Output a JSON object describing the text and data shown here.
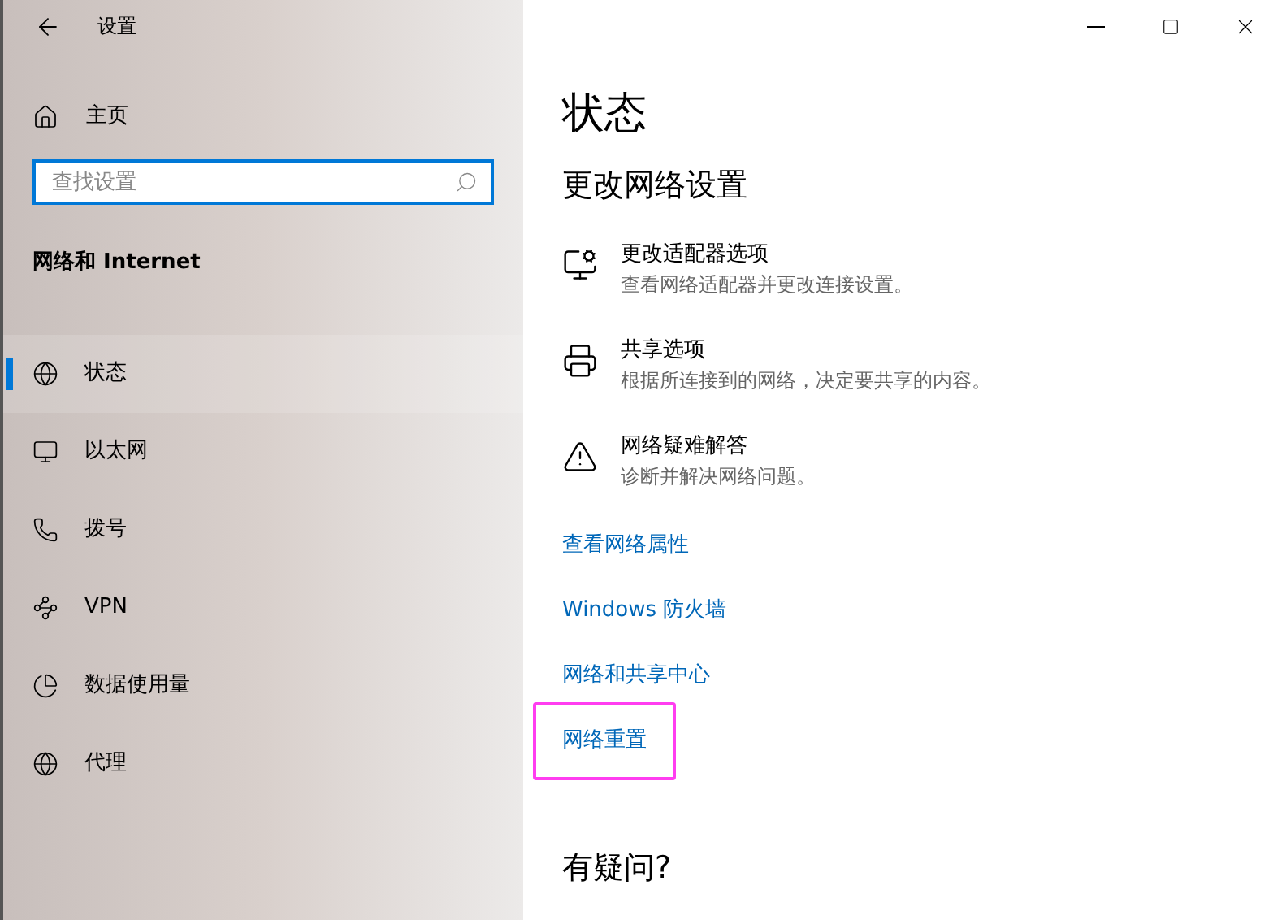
{
  "window": {
    "title": "设置"
  },
  "sidebar": {
    "home": "主页",
    "search": {
      "placeholder": "查找设置"
    },
    "section": "网络和 Internet",
    "items": [
      {
        "kind": "status",
        "label": "状态",
        "selected": true
      },
      {
        "kind": "ethernet",
        "label": "以太网",
        "selected": false
      },
      {
        "kind": "dialup",
        "label": "拨号",
        "selected": false
      },
      {
        "kind": "vpn",
        "label": "VPN",
        "selected": false
      },
      {
        "kind": "data",
        "label": "数据使用量",
        "selected": false
      },
      {
        "kind": "proxy",
        "label": "代理",
        "selected": false
      }
    ]
  },
  "main": {
    "title": "状态",
    "subtitle": "更改网络设置",
    "options": [
      {
        "kind": "adapter",
        "title": "更改适配器选项",
        "description": "查看网络适配器并更改连接设置。"
      },
      {
        "kind": "sharing",
        "title": "共享选项",
        "description": "根据所连接到的网络，决定要共享的内容。"
      },
      {
        "kind": "troubleshoot",
        "title": "网络疑难解答",
        "description": "诊断并解决网络问题。"
      }
    ],
    "links": [
      {
        "label": "查看网络属性",
        "highlighted": false
      },
      {
        "label": "Windows 防火墙",
        "highlighted": false
      },
      {
        "label": "网络和共享中心",
        "highlighted": false
      },
      {
        "label": "网络重置",
        "highlighted": true
      }
    ],
    "help_heading": "有疑问?"
  }
}
